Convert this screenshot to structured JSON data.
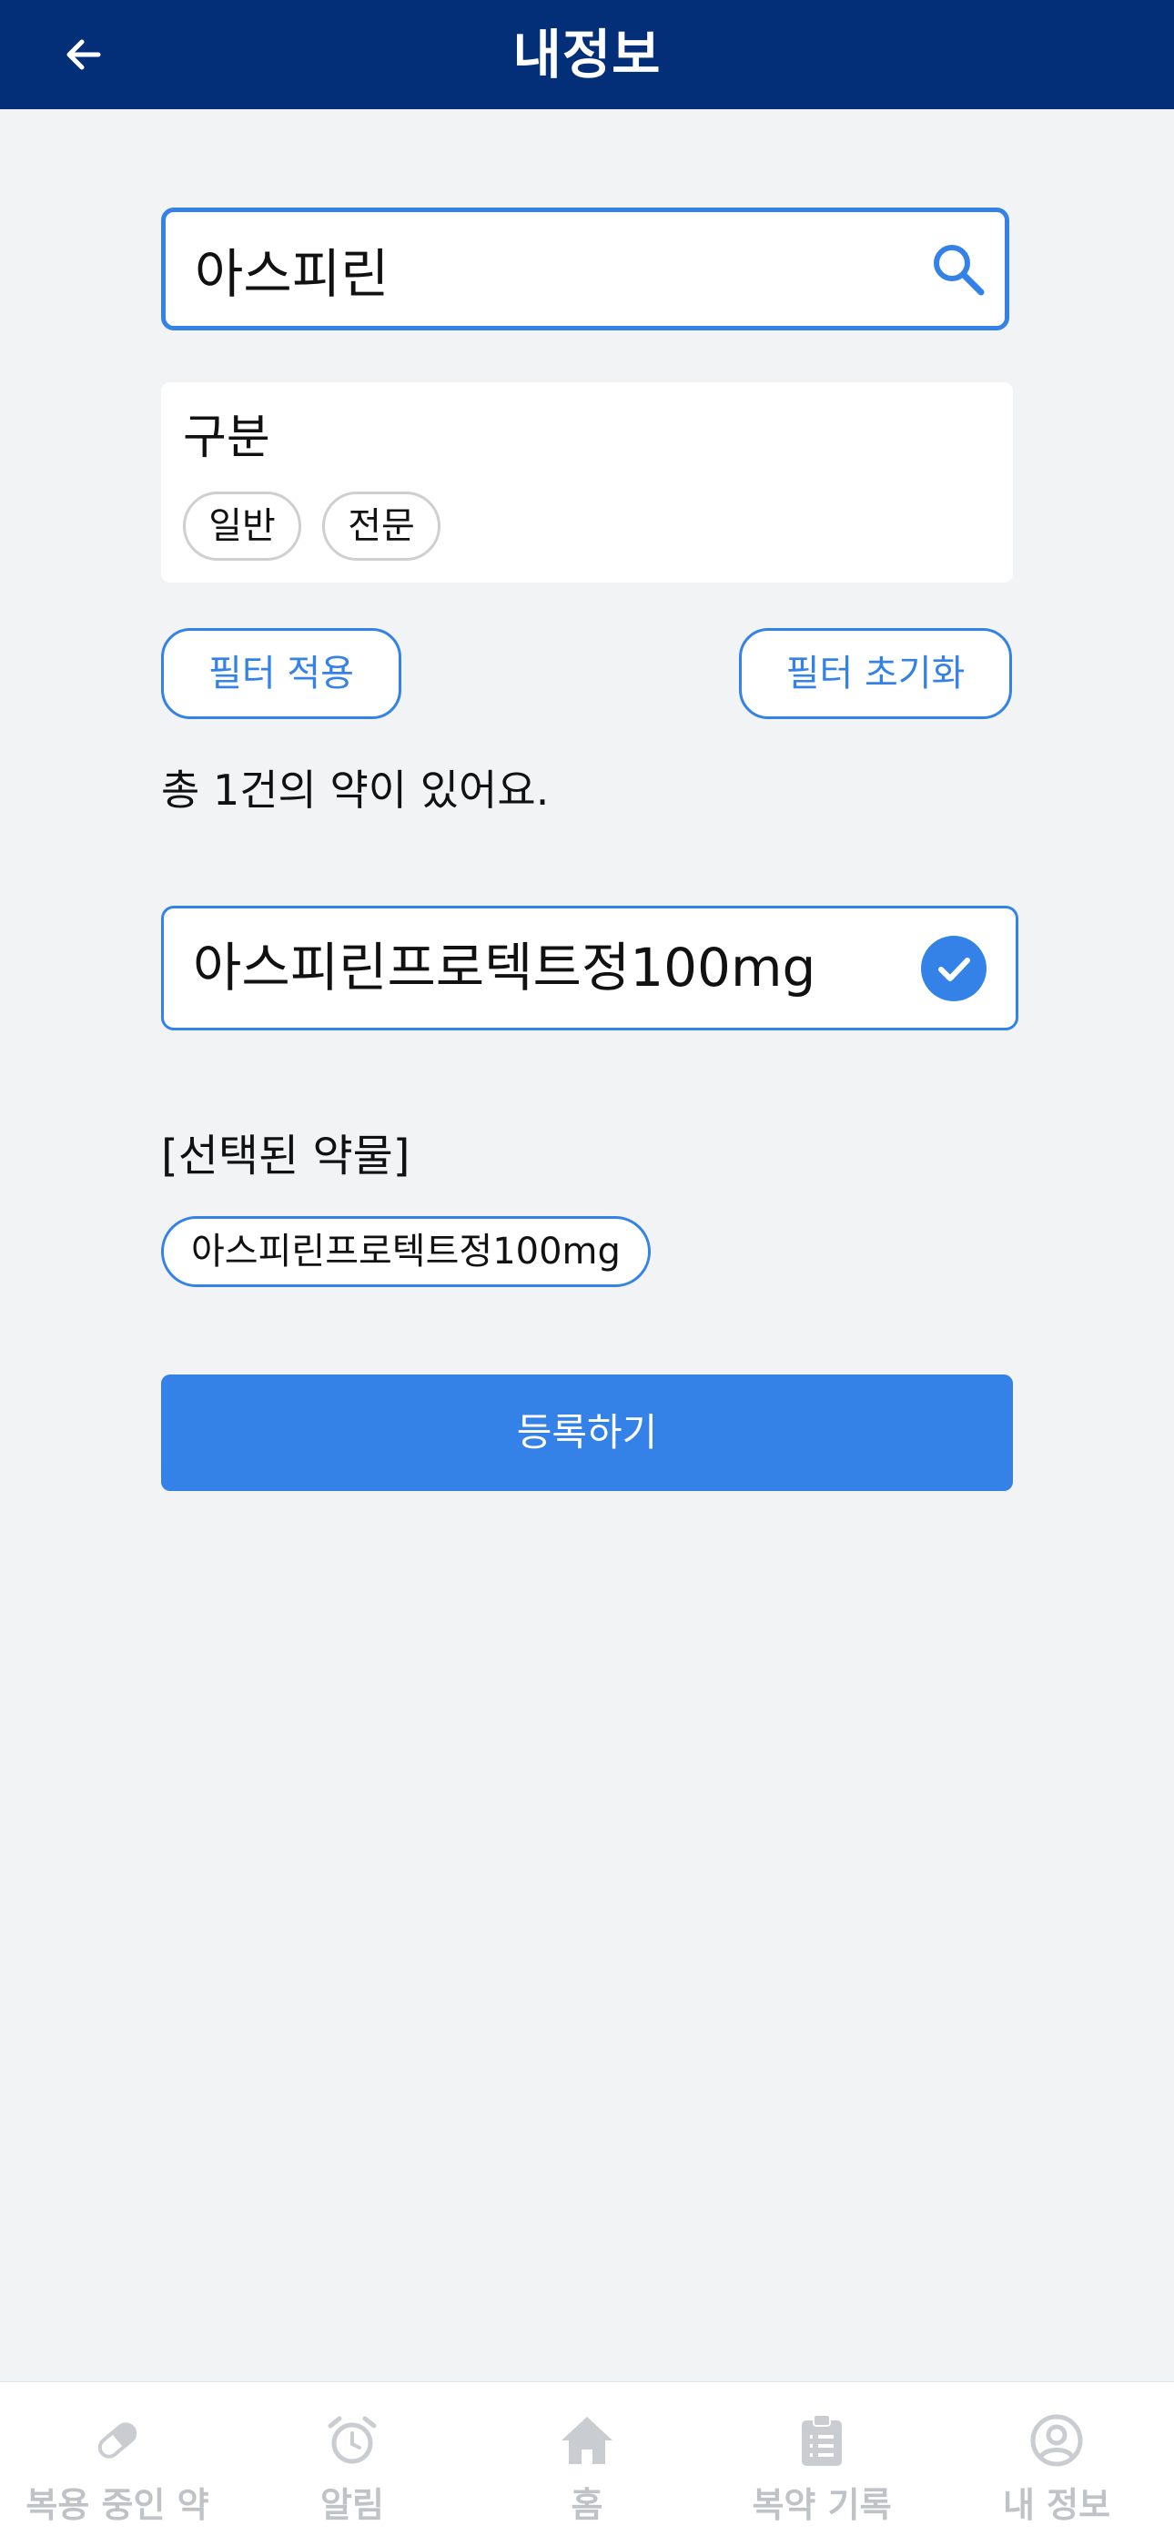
{
  "header": {
    "title": "내정보",
    "back_icon": "arrow-left-icon"
  },
  "search": {
    "value": "아스피린",
    "placeholder": "",
    "icon": "search-icon"
  },
  "filter": {
    "title": "구분",
    "options": [
      "일반",
      "전문"
    ]
  },
  "buttons": {
    "apply": "필터 적용",
    "reset": "필터 초기화",
    "submit": "등록하기"
  },
  "results": {
    "summary": "총 1건의 약이 있어요.",
    "items": [
      {
        "name": "아스피린프로텍트정100mg",
        "selected": true
      }
    ]
  },
  "selected": {
    "label": "[선택된 약물]",
    "items": [
      "아스피린프로텍트정100mg"
    ]
  },
  "tabbar": {
    "items": [
      {
        "label": "복용 중인 약",
        "icon": "pill-icon"
      },
      {
        "label": "알림",
        "icon": "alarm-clock-icon"
      },
      {
        "label": "홈",
        "icon": "home-icon"
      },
      {
        "label": "복약 기록",
        "icon": "clipboard-icon"
      },
      {
        "label": "내 정보",
        "icon": "user-icon"
      }
    ]
  },
  "colors": {
    "header_bg": "#032f78",
    "accent": "#3482e8",
    "background": "#f2f3f5",
    "tab_inactive": "#bfc3c8"
  }
}
